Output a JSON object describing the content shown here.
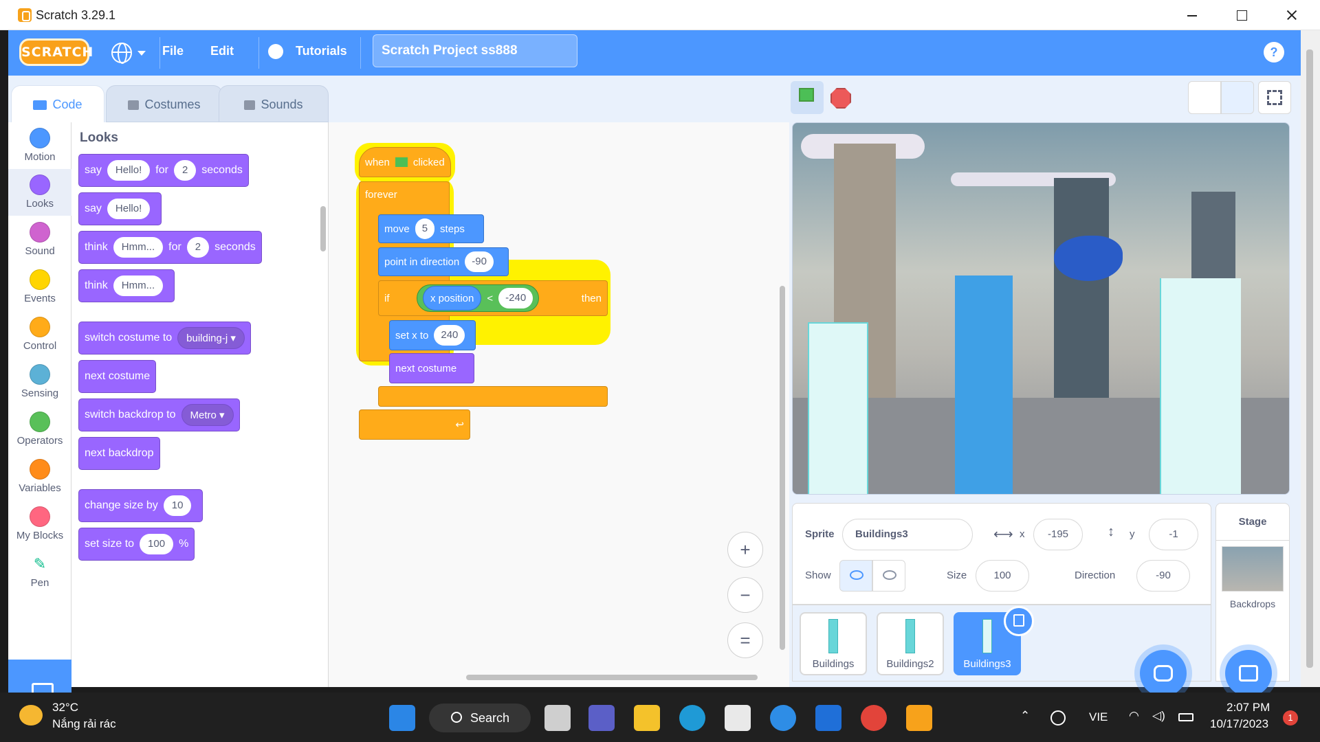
{
  "window": {
    "title": "Scratch 3.29.1"
  },
  "menubar": {
    "logo": "SCRATCH",
    "file": "File",
    "edit": "Edit",
    "tutorials": "Tutorials",
    "project_title": "Scratch Project ss888",
    "help": "?"
  },
  "tabs": [
    {
      "label": "Code",
      "active": true
    },
    {
      "label": "Costumes",
      "active": false
    },
    {
      "label": "Sounds",
      "active": false
    }
  ],
  "categories": [
    {
      "label": "Motion",
      "color": "#4c97ff"
    },
    {
      "label": "Looks",
      "color": "#9966ff"
    },
    {
      "label": "Sound",
      "color": "#cf63cf"
    },
    {
      "label": "Events",
      "color": "#ffd500"
    },
    {
      "label": "Control",
      "color": "#ffab19"
    },
    {
      "label": "Sensing",
      "color": "#5cb1d6"
    },
    {
      "label": "Operators",
      "color": "#59c059"
    },
    {
      "label": "Variables",
      "color": "#ff8c1a"
    },
    {
      "label": "My Blocks",
      "color": "#ff6680"
    },
    {
      "label": "Pen",
      "color": "#0fbd8c"
    }
  ],
  "palette": {
    "heading": "Looks",
    "b1": {
      "say": "say",
      "msg": "Hello!",
      "for": "for",
      "secs": "2",
      "seconds": "seconds"
    },
    "b2": {
      "say": "say",
      "msg": "Hello!"
    },
    "b3": {
      "think": "think",
      "msg": "Hmm...",
      "for": "for",
      "secs": "2",
      "seconds": "seconds"
    },
    "b4": {
      "think": "think",
      "msg": "Hmm..."
    },
    "b5": {
      "text": "switch costume to",
      "value": "building-j"
    },
    "b6": {
      "text": "next costume"
    },
    "b7": {
      "text": "switch backdrop to",
      "value": "Metro"
    },
    "b8": {
      "text": "next backdrop"
    },
    "b9": {
      "text": "change size by",
      "value": "10"
    },
    "b10": {
      "text": "set size to",
      "value": "100",
      "unit": "%"
    }
  },
  "script": {
    "when": "when",
    "clicked": "clicked",
    "forever": "forever",
    "move": "move",
    "move_steps": "5",
    "steps": "steps",
    "point_in_direction": "point in direction",
    "direction": "-90",
    "if": "if",
    "x_position": "x position",
    "lt": "<",
    "compare_value": "-240",
    "then": "then",
    "set_x_to": "set x to",
    "set_x_value": "240",
    "next_costume": "next costume"
  },
  "workspace_zoom": {
    "in": "+",
    "out": "−",
    "reset": "="
  },
  "sprite_info": {
    "sprite_label": "Sprite",
    "sprite_name": "Buildings3",
    "x_label": "x",
    "x_value": "-195",
    "y_label": "y",
    "y_value": "-1",
    "show_label": "Show",
    "size_label": "Size",
    "size_value": "100",
    "direction_label": "Direction",
    "direction_value": "-90"
  },
  "sprites": [
    {
      "name": "Buildings",
      "selected": false
    },
    {
      "name": "Buildings2",
      "selected": false
    },
    {
      "name": "Buildings3",
      "selected": true
    }
  ],
  "stage_panel": {
    "title": "Stage",
    "backdrops": "Backdrops"
  },
  "taskbar": {
    "weather_temp": "32°C",
    "weather_desc": "Nắng rải rác",
    "search": "Search",
    "language": "VIE",
    "time": "2:07 PM",
    "date": "10/17/2023",
    "notifications": "1"
  }
}
